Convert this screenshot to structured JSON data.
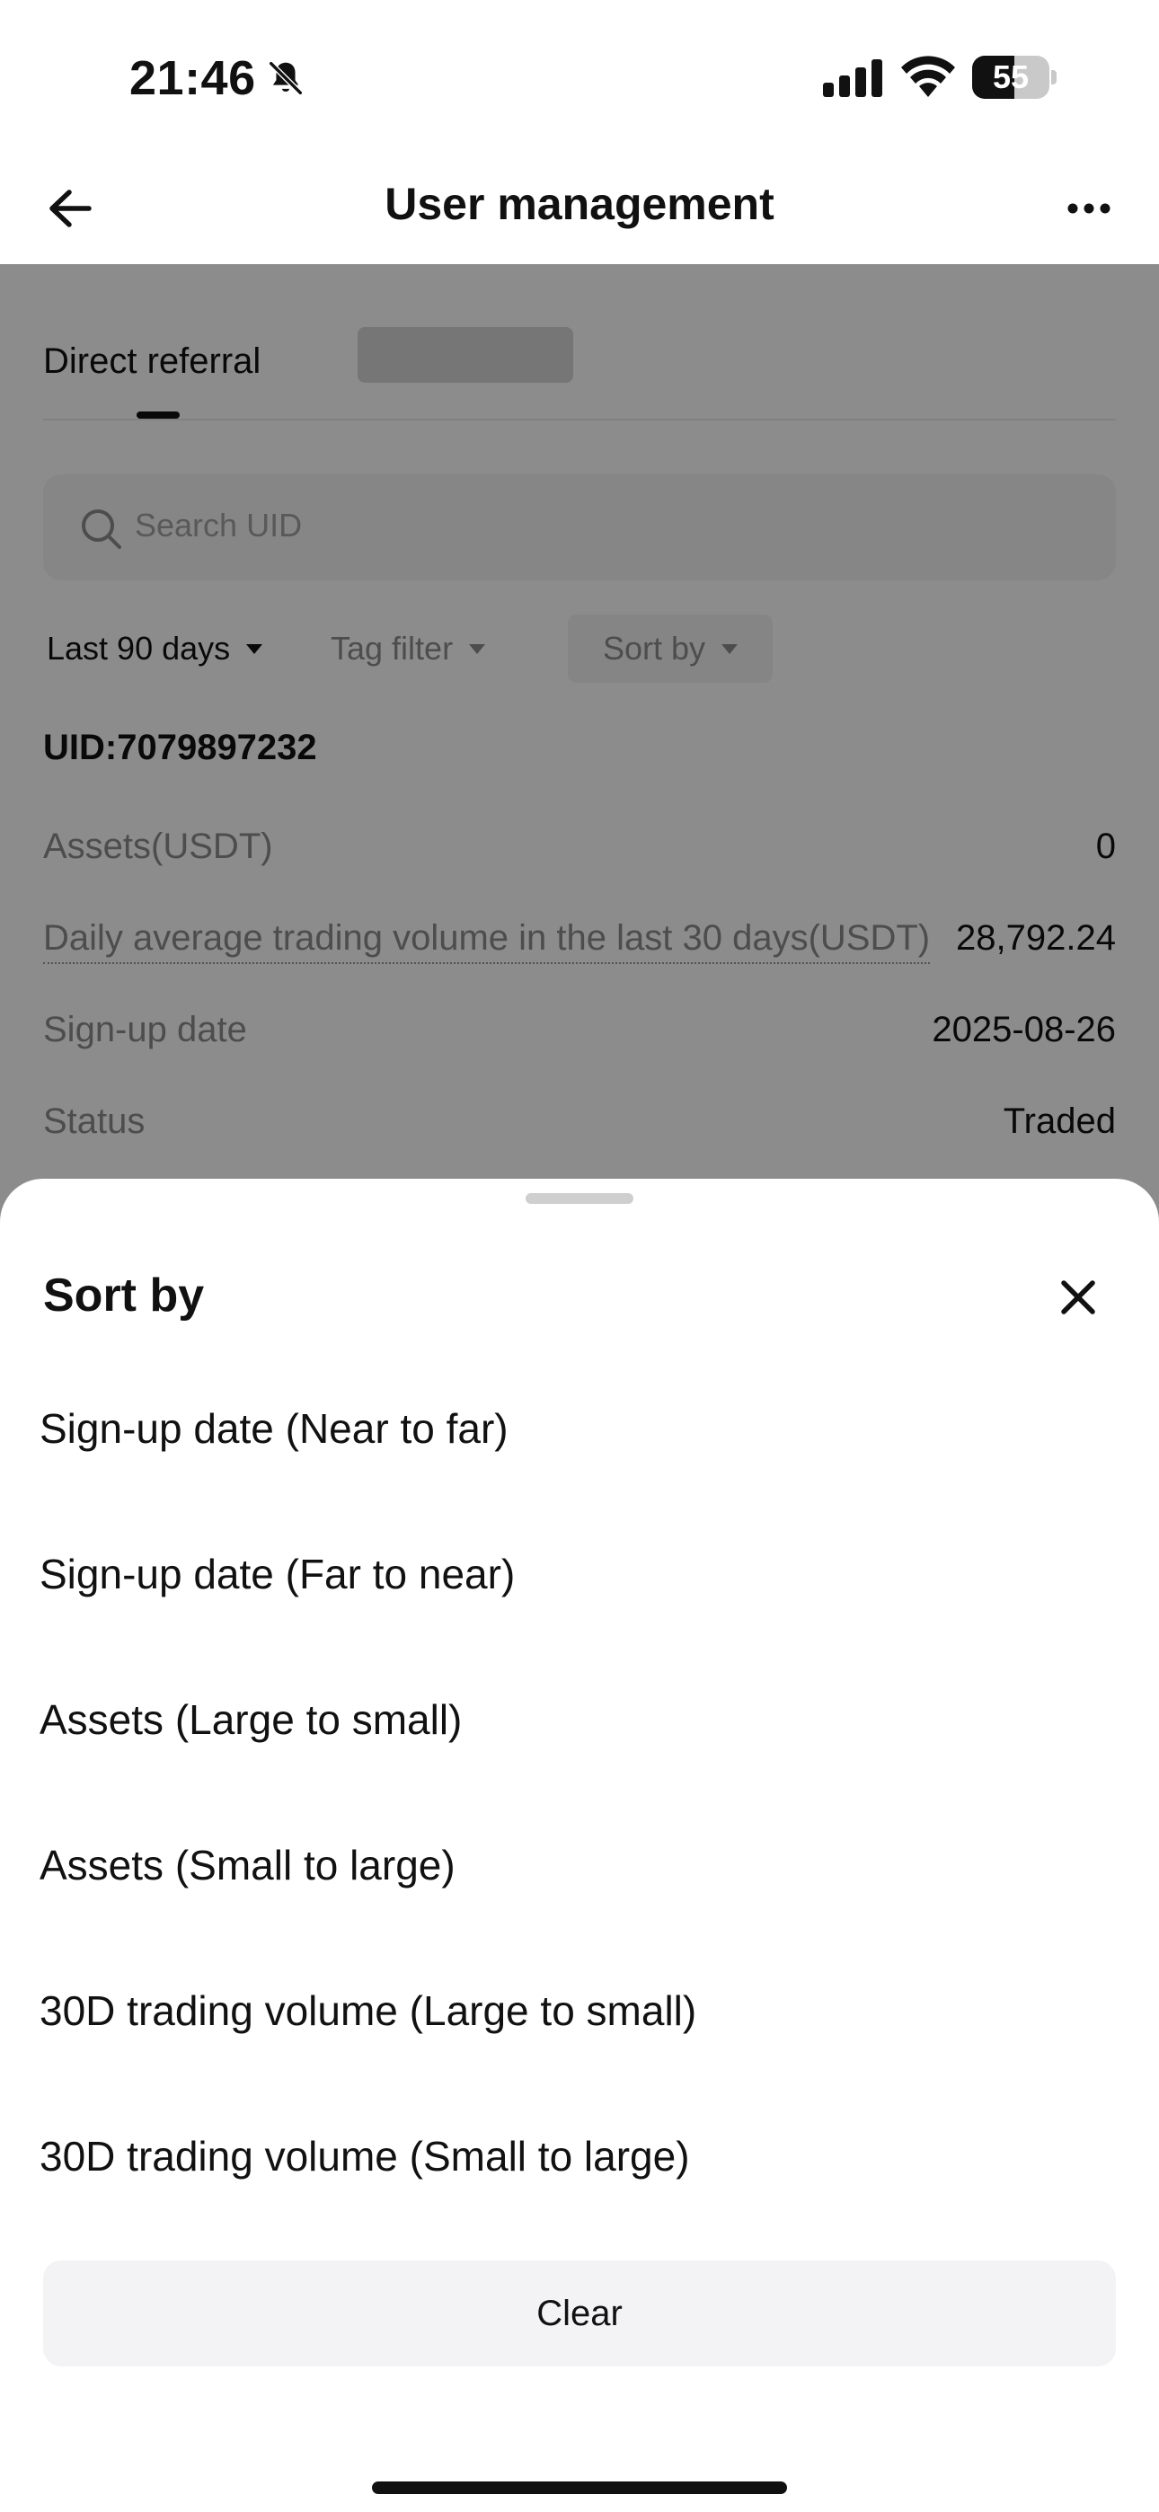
{
  "status_bar": {
    "time": "21:46",
    "battery_level": "55",
    "icons": [
      "bell-muted-icon",
      "cellular-signal-icon",
      "wifi-icon",
      "battery-icon"
    ]
  },
  "header": {
    "title": "User management",
    "back_icon": "arrow-left-icon",
    "more_icon": "more-dots-icon"
  },
  "tabs": {
    "active": "Direct referral"
  },
  "search": {
    "placeholder": "Search UID",
    "icon": "search-icon"
  },
  "filters": {
    "period": "Last 90 days",
    "tag": "Tag filter",
    "sort": "Sort by"
  },
  "user": {
    "uid": "UID:7079897232",
    "rows": [
      {
        "label": "Assets(USDT)",
        "value": "0"
      },
      {
        "label": "Daily average trading volume in the last 30 days(USDT)",
        "value": "28,792.24"
      },
      {
        "label": "Sign-up date",
        "value": "2025-08-26"
      },
      {
        "label": "Status",
        "value": "Traded"
      }
    ]
  },
  "sort_sheet": {
    "title": "Sort by",
    "close_icon": "close-icon",
    "options": [
      "Sign-up date (Near to far)",
      "Sign-up date (Far to near)",
      "Assets (Large to small)",
      "Assets (Small to large)",
      "30D trading volume (Large to small)",
      "30D trading volume (Small to large)"
    ],
    "clear_label": "Clear"
  },
  "colors": {
    "scrim": "#000000",
    "text_primary": "#111111",
    "text_secondary": "#8c8c8c",
    "button_bg": "#f3f3f5"
  }
}
